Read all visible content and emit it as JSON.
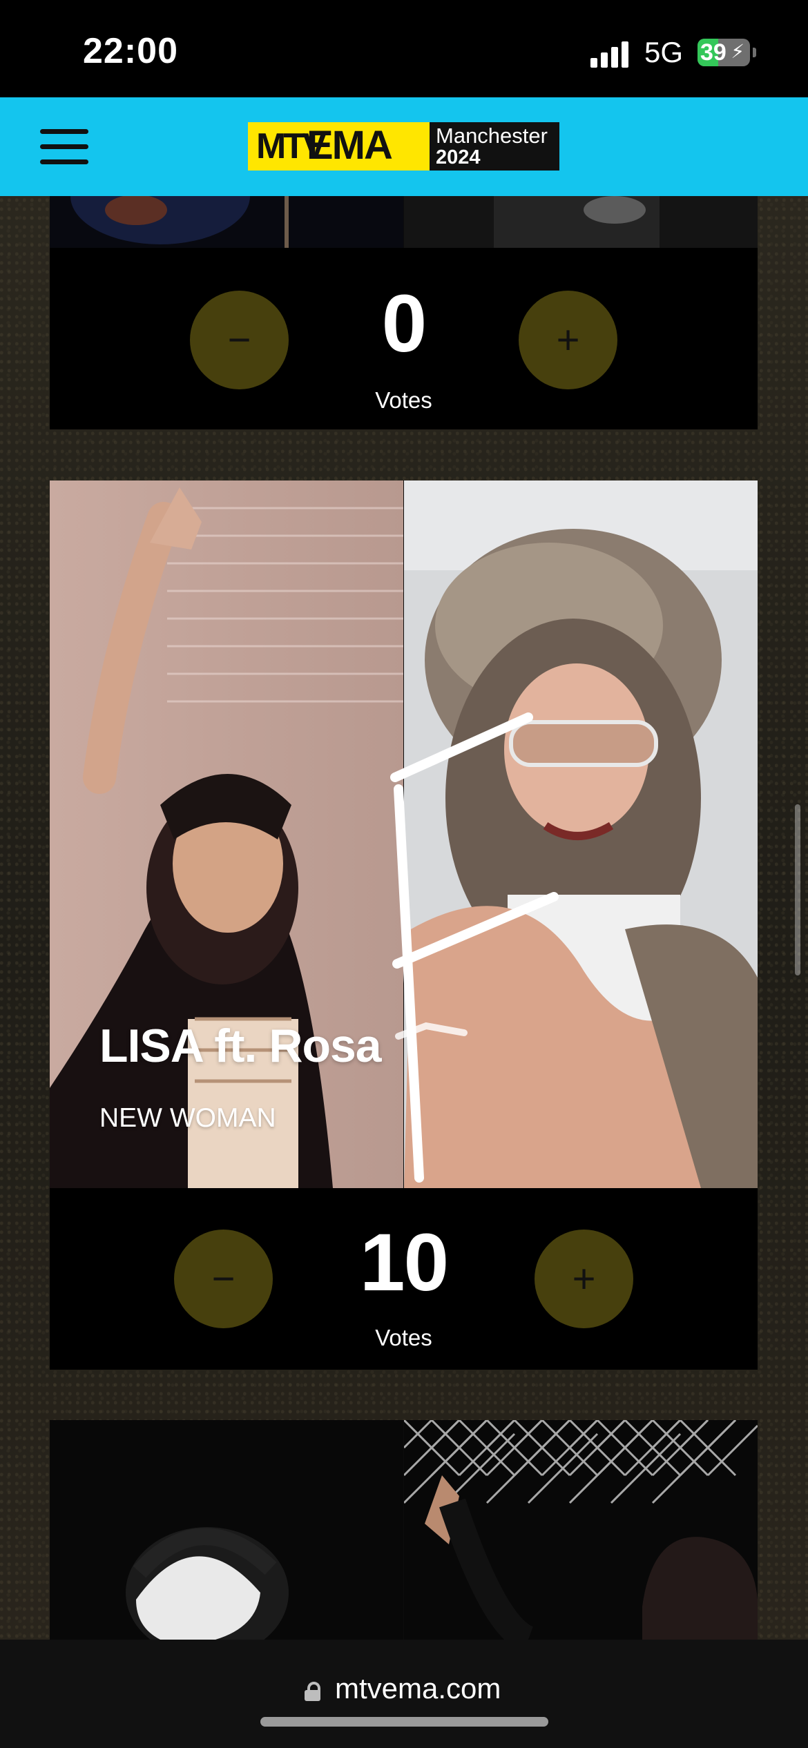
{
  "status_bar": {
    "time": "22:00",
    "network": "5G",
    "battery_percent": "39",
    "battery_level": 0.39,
    "battery_icon": "charging-bolt-icon"
  },
  "header": {
    "menu_icon": "hamburger-menu-icon",
    "logo": {
      "mtv": "MTV",
      "ema": "EMA",
      "city": "Manchester",
      "year": "2024"
    },
    "colors": {
      "background": "#14c5ee",
      "logo_yellow": "#ffe600"
    }
  },
  "cards": [
    {
      "votes": "0",
      "votes_label": "Votes",
      "minus_label": "−",
      "plus_label": "+"
    },
    {
      "title": "LISA ft. Rosa",
      "subtitle": "NEW WOMAN",
      "votes": "10",
      "votes_label": "Votes",
      "minus_label": "−",
      "plus_label": "+"
    }
  ],
  "address_bar": {
    "url": "mtvema.com",
    "icon": "lock-icon"
  }
}
